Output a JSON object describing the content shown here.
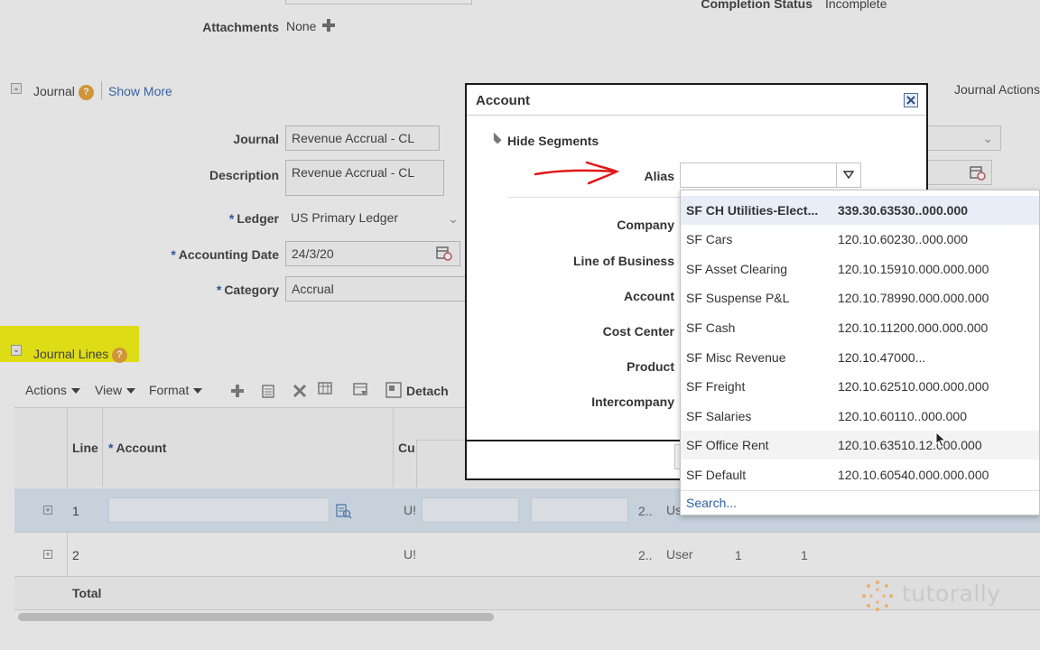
{
  "header": {
    "attachments_label": "Attachments",
    "attachments_value": "None",
    "completion_status_label": "Completion Status",
    "completion_status_value": "Incomplete"
  },
  "journal_section": {
    "title": "Journal",
    "show_more": "Show More",
    "journal_actions": "Journal Actions"
  },
  "form": {
    "journal_label": "Journal",
    "journal_value": "Revenue Accrual - CL",
    "description_label": "Description",
    "description_value": "Revenue Accrual - CL",
    "ledger_label": "Ledger",
    "ledger_value": "US Primary Ledger",
    "accounting_date_label": "Accounting Date",
    "accounting_date_value": "24/3/20",
    "category_label": "Category",
    "category_value": "Accrual",
    "required_marker": "*"
  },
  "journal_lines": {
    "title": "Journal Lines",
    "toolbar": {
      "actions": "Actions",
      "view": "View",
      "format": "Format",
      "detach": "Detach"
    },
    "columns": {
      "line": "Line",
      "account": "Account",
      "currency": "Cu"
    },
    "rows": [
      {
        "line": "1",
        "cur": "U!",
        "col4": "2..",
        "col5": "Us"
      },
      {
        "line": "2",
        "cur": "U!",
        "col4": "2..",
        "col5": "User",
        "col6": "1",
        "col7": "1"
      }
    ],
    "total": "Total"
  },
  "dialog": {
    "title": "Account",
    "hide_segments": "Hide Segments",
    "alias_label": "Alias",
    "alias_value": "",
    "segments": [
      "Company",
      "Line of Business",
      "Account",
      "Cost Center",
      "Product",
      "Intercompany"
    ]
  },
  "alias_dropdown": {
    "items": [
      {
        "alias": "SF CH Utilities-Elect...",
        "code": "339.30.63530..000.000"
      },
      {
        "alias": "SF Cars",
        "code": "120.10.60230..000.000"
      },
      {
        "alias": "SF Asset Clearing",
        "code": "120.10.15910.000.000.000"
      },
      {
        "alias": "SF Suspense P&L",
        "code": "120.10.78990.000.000.000"
      },
      {
        "alias": "SF Cash",
        "code": "120.10.11200.000.000.000"
      },
      {
        "alias": "SF Misc Revenue",
        "code": "120.10.47000..."
      },
      {
        "alias": "SF Freight",
        "code": "120.10.62510.000.000.000"
      },
      {
        "alias": "SF Salaries",
        "code": "120.10.60110..000.000"
      },
      {
        "alias": "SF Office Rent",
        "code": "120.10.63510.12.000.000"
      },
      {
        "alias": "SF Default",
        "code": "120.10.60540.000.000.000"
      }
    ],
    "search": "Search..."
  },
  "watermark": "tutorally",
  "colors": {
    "highlight": "#f5f200",
    "link": "#2a5fa8",
    "annotation_arrow": "#e01818",
    "dialog_border": "#1a1a1a"
  }
}
